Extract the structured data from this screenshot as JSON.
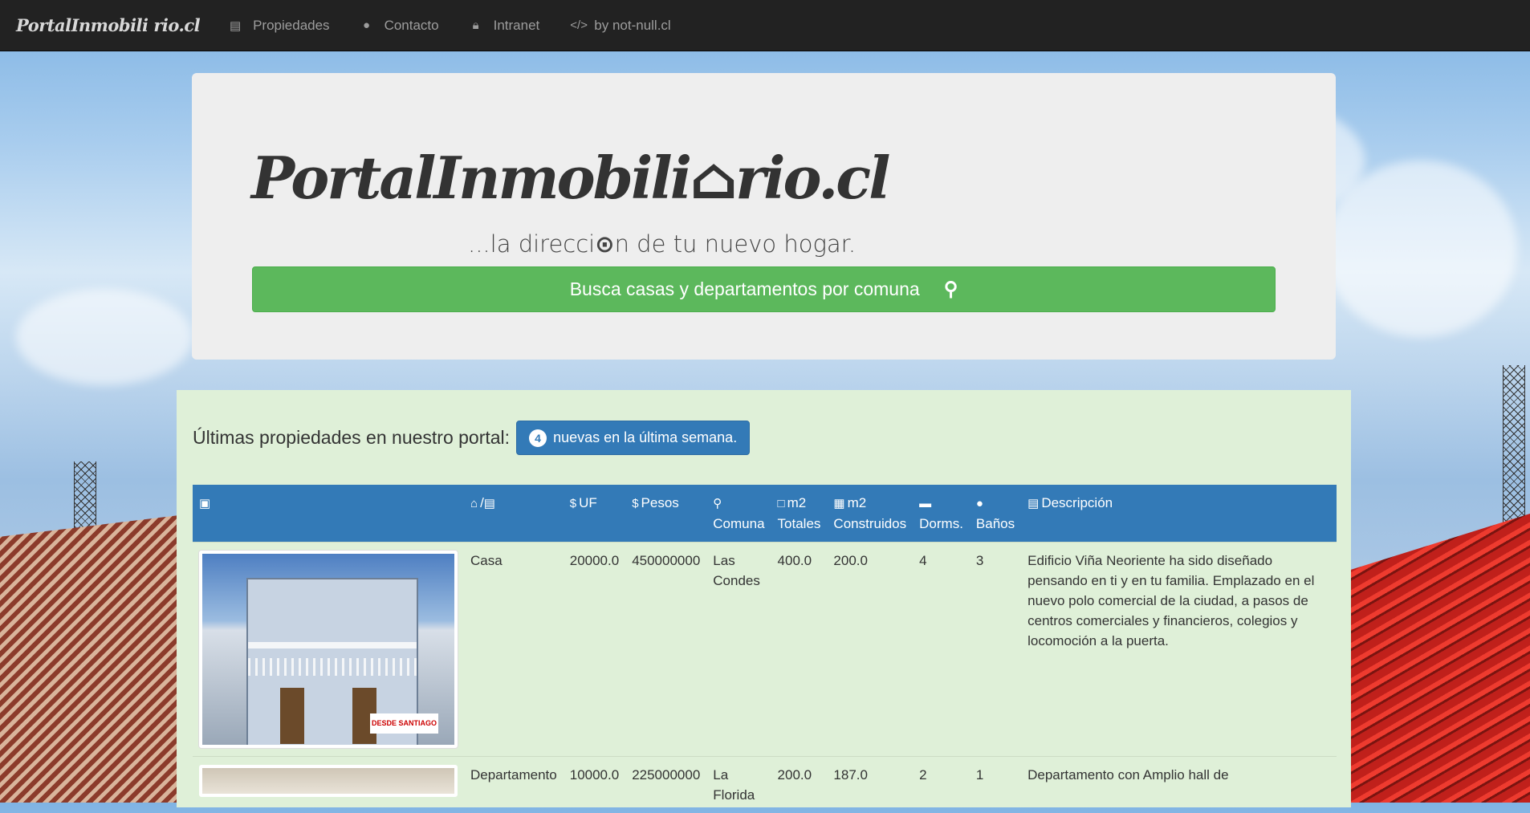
{
  "navbar": {
    "brand": "PortalInmobili rio.cl",
    "items": [
      {
        "label": "Propiedades",
        "icon": "building-icon"
      },
      {
        "label": "Contacto",
        "icon": "comments-icon"
      },
      {
        "label": "Intranet",
        "icon": "lock-icon"
      },
      {
        "label": "by not-null.cl",
        "icon": "code-icon"
      }
    ]
  },
  "hero": {
    "logo_left": "PortalInmobili",
    "logo_right": "rio.cl",
    "tagline_left": "...la direcci",
    "tagline_right": "n de tu nuevo hogar.",
    "search_button": "Busca casas y departamentos por comuna"
  },
  "latest": {
    "title": "Últimas propiedades en nuestro portal:",
    "badge_count": "4",
    "badge_text": "nuevas en la última semana."
  },
  "table": {
    "headers": {
      "tipo_sep": "/",
      "uf": "UF",
      "pesos": "Pesos",
      "comuna": "Comuna",
      "m2_tot_1": "m2",
      "m2_tot_2": "Totales",
      "m2_con_1": "m2",
      "m2_con_2": "Construidos",
      "dorms": "Dorms.",
      "banos": "Baños",
      "descripcion": "Descripción"
    },
    "rows": [
      {
        "tipo": "Casa",
        "uf": "20000.0",
        "pesos": "450000000",
        "comuna": "Las Condes",
        "m2_totales": "400.0",
        "m2_construidos": "200.0",
        "dorms": "4",
        "banos": "3",
        "descripcion": "Edificio Viña Neoriente ha sido diseñado pensando en ti y en tu familia. Emplazado en el nuevo polo comercial de la ciudad, a pasos de centros comerciales y financieros, colegios y locomoción a la puerta.",
        "watermark": "DESDE SANTIAGO"
      },
      {
        "tipo": "Departamento",
        "uf": "10000.0",
        "pesos": "225000000",
        "comuna": "La Florida",
        "m2_totales": "200.0",
        "m2_construidos": "187.0",
        "dorms": "2",
        "banos": "1",
        "descripcion": "Departamento con Amplio hall de"
      }
    ]
  },
  "colors": {
    "navbar": "#222222",
    "success": "#5cb85c",
    "primary": "#337ab7",
    "panel": "#dff0d8"
  }
}
